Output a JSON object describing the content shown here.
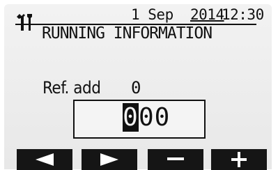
{
  "header": {
    "date": "1 Sep",
    "year": "2014",
    "time": "12:30",
    "title": "RUNNING INFORMATION",
    "icon": "wrench-screwdriver-icon"
  },
  "content": {
    "field_label": "Ref. add",
    "field_value": "0",
    "input": {
      "cursor_digit": "0",
      "rest_digits": "00"
    }
  },
  "softkeys": [
    {
      "icon": "left-triangle-icon",
      "glyph": "◀"
    },
    {
      "icon": "right-triangle-icon",
      "glyph": "▶"
    },
    {
      "icon": "minus-icon",
      "glyph": "−"
    },
    {
      "icon": "plus-icon",
      "glyph": "+"
    }
  ],
  "colors": {
    "screen_background": "#eeeeee",
    "foreground": "#111111",
    "softkey_background": "#151515",
    "softkey_glyph": "#ffffff"
  }
}
